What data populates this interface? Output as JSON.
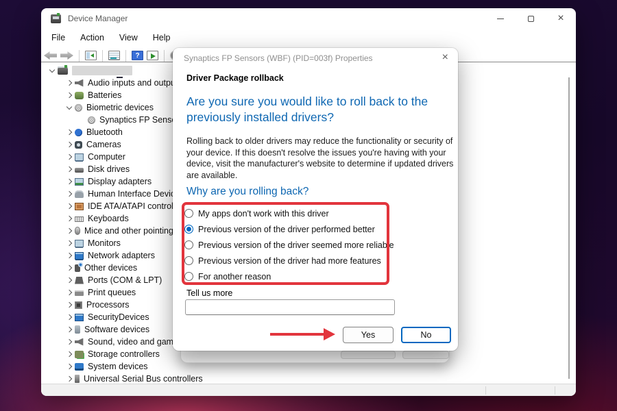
{
  "window": {
    "title": "Device Manager",
    "controls": [
      "minimize",
      "maximize",
      "close"
    ]
  },
  "menu": {
    "items": [
      "File",
      "Action",
      "View",
      "Help"
    ]
  },
  "toolbar": {
    "icons": [
      "back-arrow",
      "forward-arrow",
      "console-tree-toggle",
      "properties",
      "help",
      "show-window",
      "update-driver"
    ]
  },
  "tree": {
    "root": {
      "label_redacted": true,
      "icon": "computer-root",
      "state": "expanded"
    },
    "items": [
      {
        "label": "Audio inputs and outputs",
        "icon": "speaker",
        "state": "collapsed",
        "level": 1
      },
      {
        "label": "Batteries",
        "icon": "battery",
        "state": "collapsed",
        "level": 1
      },
      {
        "label": "Biometric devices",
        "icon": "fingerprint",
        "state": "expanded",
        "level": 1
      },
      {
        "label": "Synaptics FP Sensors",
        "icon": "fingerprint",
        "state": "child",
        "level": 2
      },
      {
        "label": "Bluetooth",
        "icon": "bluetooth",
        "state": "collapsed",
        "level": 1
      },
      {
        "label": "Cameras",
        "icon": "camera",
        "state": "collapsed",
        "level": 1
      },
      {
        "label": "Computer",
        "icon": "monitor",
        "state": "collapsed",
        "level": 1
      },
      {
        "label": "Disk drives",
        "icon": "disk",
        "state": "collapsed",
        "level": 1
      },
      {
        "label": "Display adapters",
        "icon": "gpu",
        "state": "collapsed",
        "level": 1
      },
      {
        "label": "Human Interface Devices",
        "icon": "hid",
        "state": "collapsed",
        "level": 1
      },
      {
        "label": "IDE ATA/ATAPI controllers",
        "icon": "chip",
        "state": "collapsed",
        "level": 1
      },
      {
        "label": "Keyboards",
        "icon": "keyboard",
        "state": "collapsed",
        "level": 1
      },
      {
        "label": "Mice and other pointing devices",
        "icon": "mouse",
        "state": "collapsed",
        "level": 1
      },
      {
        "label": "Monitors",
        "icon": "monitor",
        "state": "collapsed",
        "level": 1
      },
      {
        "label": "Network adapters",
        "icon": "network",
        "state": "collapsed",
        "level": 1
      },
      {
        "label": "Other devices",
        "icon": "other",
        "state": "collapsed",
        "level": 1
      },
      {
        "label": "Ports (COM & LPT)",
        "icon": "port",
        "state": "collapsed",
        "level": 1
      },
      {
        "label": "Print queues",
        "icon": "printer",
        "state": "collapsed",
        "level": 1
      },
      {
        "label": "Processors",
        "icon": "processor",
        "state": "collapsed",
        "level": 1
      },
      {
        "label": "SecurityDevices",
        "icon": "security",
        "state": "collapsed",
        "level": 1
      },
      {
        "label": "Software devices",
        "icon": "software",
        "state": "collapsed",
        "level": 1
      },
      {
        "label": "Sound, video and game controllers",
        "icon": "speaker",
        "state": "collapsed",
        "level": 1
      },
      {
        "label": "Storage controllers",
        "icon": "storage",
        "state": "collapsed",
        "level": 1
      },
      {
        "label": "System devices",
        "icon": "system",
        "state": "collapsed",
        "level": 1
      },
      {
        "label": "Universal Serial Bus controllers",
        "icon": "usb",
        "state": "collapsed",
        "level": 1
      }
    ]
  },
  "dialog": {
    "title": "Synaptics FP Sensors (WBF) (PID=003f) Properties",
    "header": "Driver Package rollback",
    "question": "Are you sure you would like to roll back to the previously installed drivers?",
    "body": "Rolling back to older drivers may reduce the functionality or security of your device.  If this doesn't resolve the issues you're having with your device, visit the manufacturer's website to determine if updated drivers are available.",
    "why_heading": "Why are you rolling back?",
    "options": [
      {
        "label": "My apps don't work with this driver",
        "selected": false
      },
      {
        "label": "Previous version of the driver performed better",
        "selected": true
      },
      {
        "label": "Previous version of the driver seemed more reliable",
        "selected": false
      },
      {
        "label": "Previous version of the driver had more features",
        "selected": false
      },
      {
        "label": "For another reason",
        "selected": false
      }
    ],
    "tell_us_more_label": "Tell us more",
    "input_value": "",
    "input_placeholder": "",
    "yes_label": "Yes",
    "no_label": "No"
  },
  "colors": {
    "accent_blue": "#0067c0",
    "heading_blue": "#0e67b2",
    "annotation_red": "#e2353d"
  }
}
